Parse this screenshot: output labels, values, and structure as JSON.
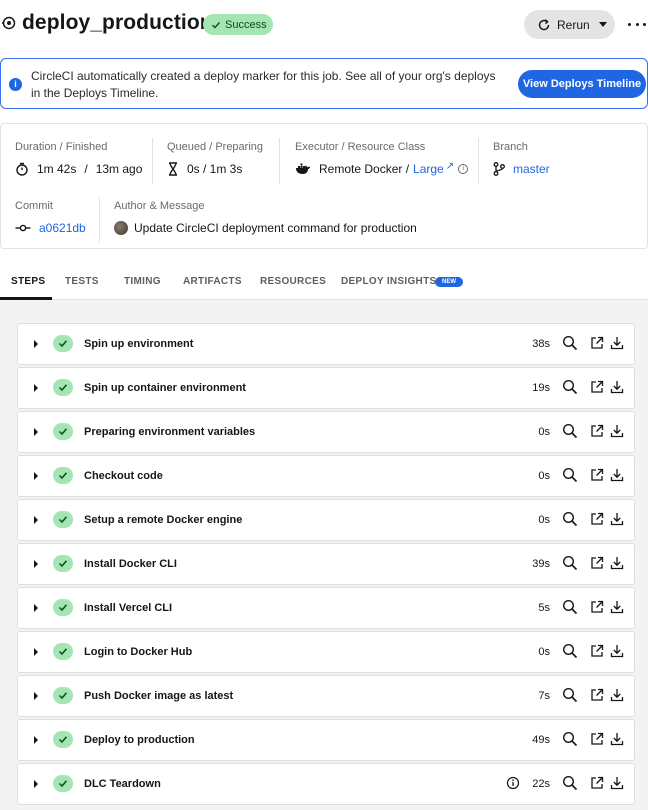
{
  "header": {
    "title": "deploy_production",
    "status": "Success",
    "rerun_label": "Rerun"
  },
  "banner": {
    "text": "CircleCI automatically created a deploy marker for this job. See all of your org's deploys in the Deploys Timeline.",
    "button": "View Deploys Timeline"
  },
  "details": {
    "duration_label": "Duration / Finished",
    "duration": "1m 42s",
    "finished": "13m ago",
    "queued_label": "Queued / Preparing",
    "queued": "0s / 1m 3s",
    "executor_label": "Executor / Resource Class",
    "executor": "Remote Docker /",
    "resource_class": "Large",
    "branch_label": "Branch",
    "branch": "master",
    "commit_label": "Commit",
    "commit": "a0621db",
    "author_label": "Author & Message",
    "message": "Update CircleCI deployment command for production"
  },
  "tabs": [
    {
      "label": "STEPS"
    },
    {
      "label": "TESTS"
    },
    {
      "label": "TIMING"
    },
    {
      "label": "ARTIFACTS"
    },
    {
      "label": "RESOURCES"
    },
    {
      "label": "DEPLOY INSIGHTS"
    }
  ],
  "new_badge": "NEW",
  "steps": [
    {
      "name": "Spin up environment",
      "duration": "38s"
    },
    {
      "name": "Spin up container environment",
      "duration": "19s"
    },
    {
      "name": "Preparing environment variables",
      "duration": "0s"
    },
    {
      "name": "Checkout code",
      "duration": "0s"
    },
    {
      "name": "Setup a remote Docker engine",
      "duration": "0s"
    },
    {
      "name": "Install Docker CLI",
      "duration": "39s"
    },
    {
      "name": "Install Vercel CLI",
      "duration": "5s"
    },
    {
      "name": "Login to Docker Hub",
      "duration": "0s"
    },
    {
      "name": "Push Docker image as latest",
      "duration": "7s"
    },
    {
      "name": "Deploy to production",
      "duration": "49s"
    },
    {
      "name": "DLC Teardown",
      "duration": "22s"
    }
  ],
  "colors": {
    "accent": "#1f66e3",
    "success_bg": "#a3e6b4"
  }
}
